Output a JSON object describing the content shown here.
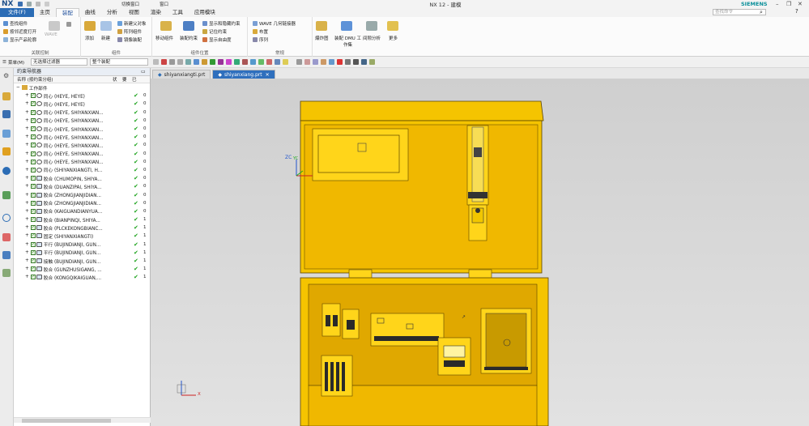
{
  "titlebar": {
    "logo": "NX",
    "window_menu": "切换窗口",
    "window_label": "窗口",
    "title": "NX 12 - 建模",
    "brand": "SIEMENS"
  },
  "menu": {
    "items": [
      "文件(F)",
      "主页",
      "装配",
      "曲线",
      "分析",
      "视图",
      "渲染",
      "工具",
      "应用模块"
    ],
    "active_index": 2,
    "search_placeholder": "查找命令"
  },
  "ribbon": {
    "groups": [
      {
        "label": "关联控制",
        "items": [
          "查找组件",
          "按邻近度打开",
          "显示产品轮廓"
        ],
        "big": "WAVE"
      },
      {
        "label": "组件",
        "big": [
          "添加",
          "新建"
        ],
        "items": [
          "新建父对象",
          "阵列组件",
          "镜像装配"
        ]
      },
      {
        "label": "组件位置",
        "big": [
          "移动组件",
          "装配约束"
        ],
        "items": [
          "显示和隐藏约束",
          "记住约束",
          "显示自由度"
        ]
      },
      {
        "label": "常规",
        "items": [
          "WAVE 几何链接器",
          "布置",
          "序列"
        ]
      },
      {
        "big": [
          "爆炸图",
          "装配 DMU 工作集",
          "间隙分析",
          "更多"
        ]
      }
    ]
  },
  "toolbar": {
    "menu_label": "菜单(M)",
    "filter": "无选择过滤器",
    "scope": "整个装配"
  },
  "navigator": {
    "title": "约束导航器",
    "columns": [
      "名称 (按约束分组)",
      "状",
      "要",
      "已"
    ],
    "root": "工作部件",
    "rows": [
      {
        "type": "同心",
        "label": "同心 (HEYE, HEYE)",
        "n": "0"
      },
      {
        "type": "同心",
        "label": "同心 (HEYE, HEYE)",
        "n": "0"
      },
      {
        "type": "同心",
        "label": "同心 (HEYE, SHIYANXIAN...",
        "n": "0"
      },
      {
        "type": "同心",
        "label": "同心 (HEYE, SHIYANXIAN...",
        "n": "0"
      },
      {
        "type": "同心",
        "label": "同心 (HEYE, SHIYANXIAN...",
        "n": "0"
      },
      {
        "type": "同心",
        "label": "同心 (HEYE, SHIYANXIAN...",
        "n": "0"
      },
      {
        "type": "同心",
        "label": "同心 (HEYE, SHIYANXIAN...",
        "n": "0"
      },
      {
        "type": "同心",
        "label": "同心 (HEYE, SHIYANXIAN...",
        "n": "0"
      },
      {
        "type": "同心",
        "label": "同心 (HEYE, SHIYANXIAN...",
        "n": "0"
      },
      {
        "type": "同心",
        "label": "同心 (SHIYANXIANGTI, H...",
        "n": "0"
      },
      {
        "type": "胶合",
        "label": "胶合 (CHUMOPIN, SHIYA...",
        "n": "0"
      },
      {
        "type": "胶合",
        "label": "胶合 (DUANZIPAI, SHIYA...",
        "n": "0"
      },
      {
        "type": "胶合",
        "label": "胶合 (ZHONGJIANJIDIAN...",
        "n": "0"
      },
      {
        "type": "胶合",
        "label": "胶合 (ZHONGJIANJIDIAN...",
        "n": "0"
      },
      {
        "type": "胶合",
        "label": "胶合 (KAIGUANDIANYUA...",
        "n": "0"
      },
      {
        "type": "胶合",
        "label": "胶合 (BIANPINQI, SHIYA...",
        "n": "1"
      },
      {
        "type": "胶合",
        "label": "胶合 (PLCKEKONGBIANC...",
        "n": "1"
      },
      {
        "type": "固定",
        "label": "固定 (SHIYANXIANGTI)",
        "n": "1"
      },
      {
        "type": "平行",
        "label": "平行 (BUJINDIANJI, GUN...",
        "n": "1"
      },
      {
        "type": "平行",
        "label": "平行 (BUJINDIANJI, GUN...",
        "n": "1"
      },
      {
        "type": "接触",
        "label": "接触 (BUJINDIANJI, GUN...",
        "n": "1"
      },
      {
        "type": "胶合",
        "label": "胶合 (GUNZHUSIGANG, ...",
        "n": "1"
      },
      {
        "type": "胶合",
        "label": "胶合 (KONGQIKAIGUAN,...",
        "n": "1"
      }
    ]
  },
  "tabs": [
    {
      "label": "shiyanxiangti.prt",
      "active": false
    },
    {
      "label": "shiyanxiang.prt",
      "active": true
    }
  ],
  "viewport": {
    "axis_top": "ZC",
    "axis_top_y": "YC",
    "axis_x": "X"
  },
  "colors": {
    "accent": "#2b6cb5",
    "model_yellow": "#f5c400",
    "brand": "#0a8f9a",
    "ok_green": "#1da31d"
  }
}
